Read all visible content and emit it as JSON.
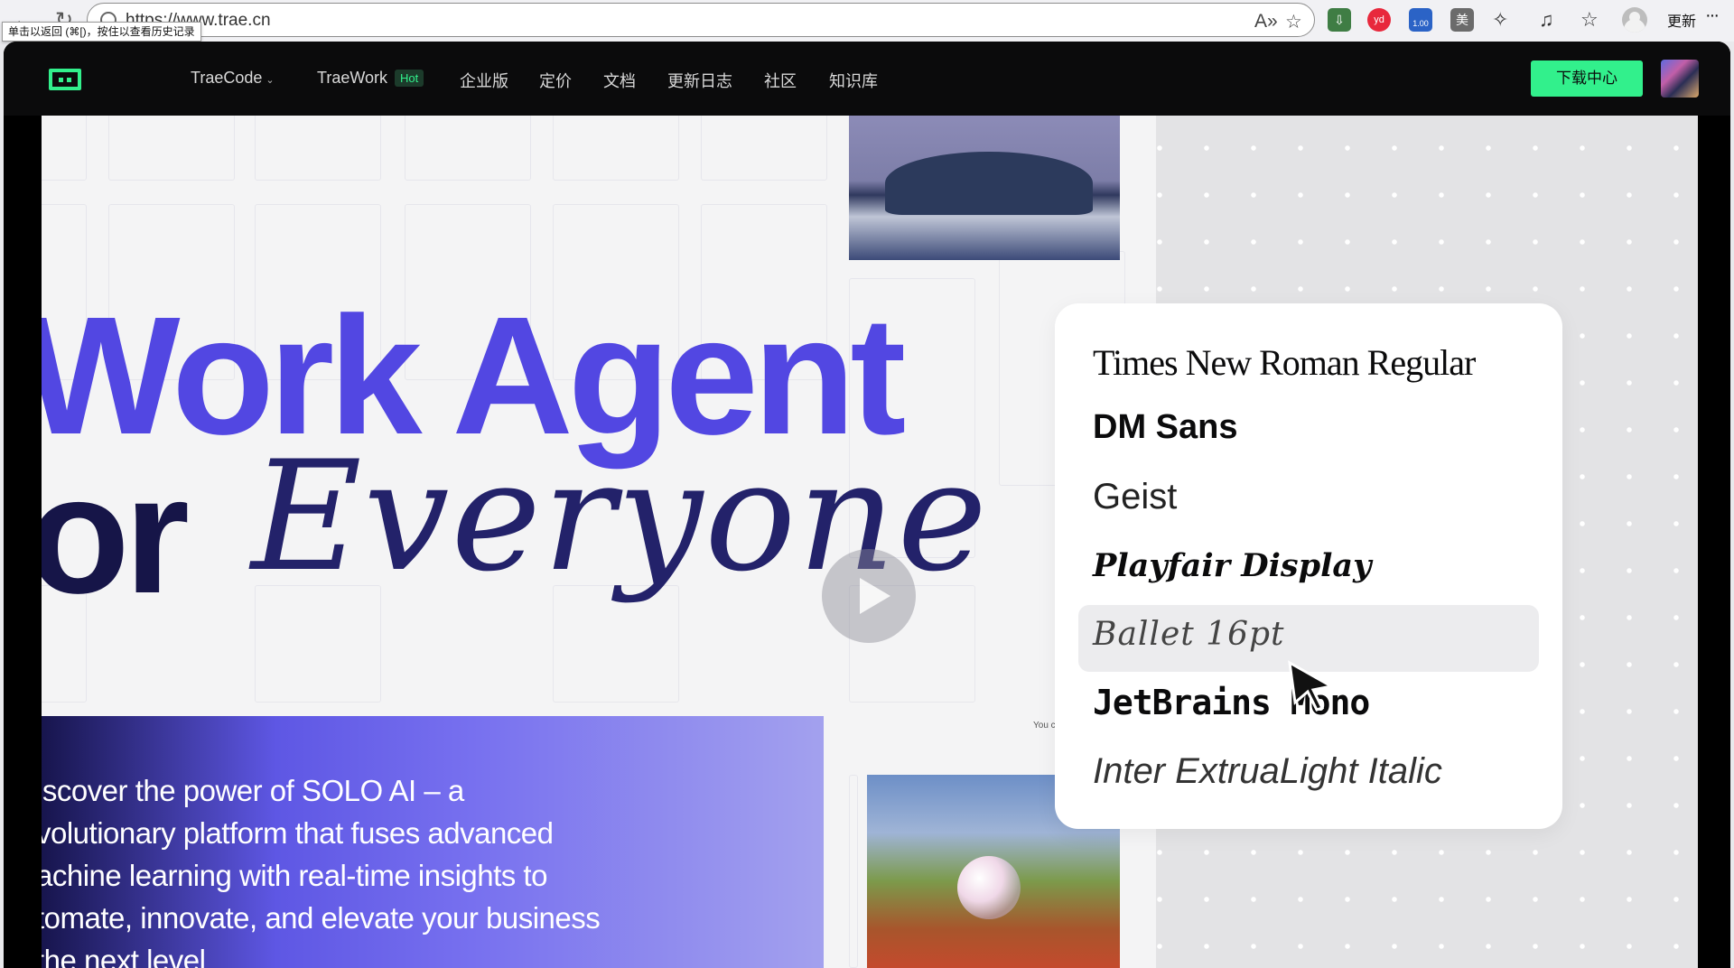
{
  "browser": {
    "url": "https://www.trae.cn",
    "tooltip": "单击以返回 (⌘[)，按住以查看历史记录",
    "update_label": "更新",
    "more_label": "···",
    "extensions": [
      {
        "name": "download-extension",
        "label": "⇩",
        "color": "#3f7d44"
      },
      {
        "name": "youdao-extension",
        "label": "yd",
        "color": "#e8283c"
      },
      {
        "name": "counter-extension",
        "label": "1.00",
        "color": "#2b63c6"
      },
      {
        "name": "mei-extension",
        "label": "美",
        "color": "#6b6b6b"
      }
    ]
  },
  "site": {
    "nav": {
      "traecode": "TraeCode",
      "traework": "TraeWork",
      "hot_badge": "Hot",
      "enterprise": "企业版",
      "pricing": "定价",
      "docs": "文档",
      "changelog": "更新日志",
      "community": "社区",
      "knowledge": "知识库"
    },
    "download_label": "下载中心"
  },
  "hero": {
    "title_line1": "Work Agent",
    "title_line2": "or",
    "title_script": "Everyone",
    "small_label": "You c",
    "description_lines": [
      "iscover the power of SOLO AI – a",
      "volutionary platform that fuses advanced",
      "achine learning with real-time insights to",
      "tomate, innovate, and elevate your business",
      " the next level"
    ]
  },
  "font_card": {
    "fonts": [
      "Times New Roman Regular",
      "DM Sans",
      "Geist",
      "Playfair Display",
      "Ballet 16pt",
      "JetBrains Mono",
      "Inter ExtruaLight Italic"
    ],
    "selected_index": 4
  },
  "colors": {
    "brand_green": "#32f08c",
    "title_purple": "#5247e2",
    "title_navy": "#161548"
  }
}
